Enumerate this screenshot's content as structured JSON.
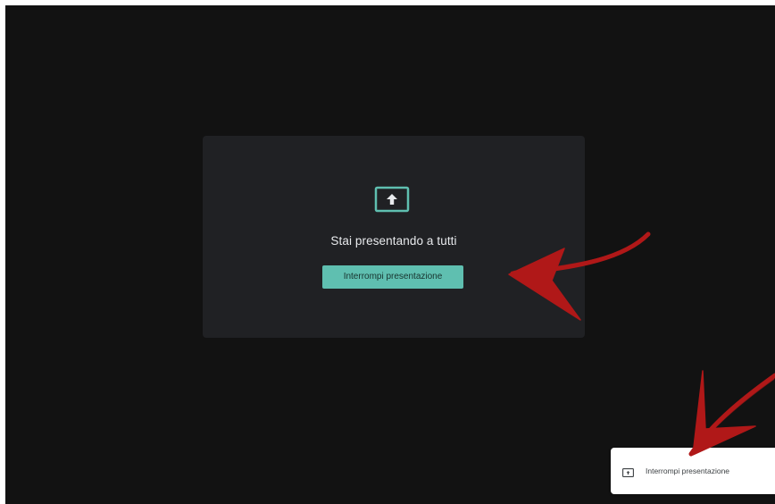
{
  "panel": {
    "icon": "present-to-all-icon",
    "title": "Stai presentando a tutti",
    "stop_button_label": "Interrompi presentazione"
  },
  "notification": {
    "icon": "present-screen-icon",
    "label": "Interrompi presentazione"
  },
  "annotations": {
    "arrow_color": "#b01818",
    "arrows": [
      "red-arrow-pointing-to-stop-button",
      "red-arrow-pointing-to-notification"
    ]
  },
  "colors": {
    "background": "#121212",
    "panel": "#202124",
    "accent": "#5fbfb0"
  }
}
